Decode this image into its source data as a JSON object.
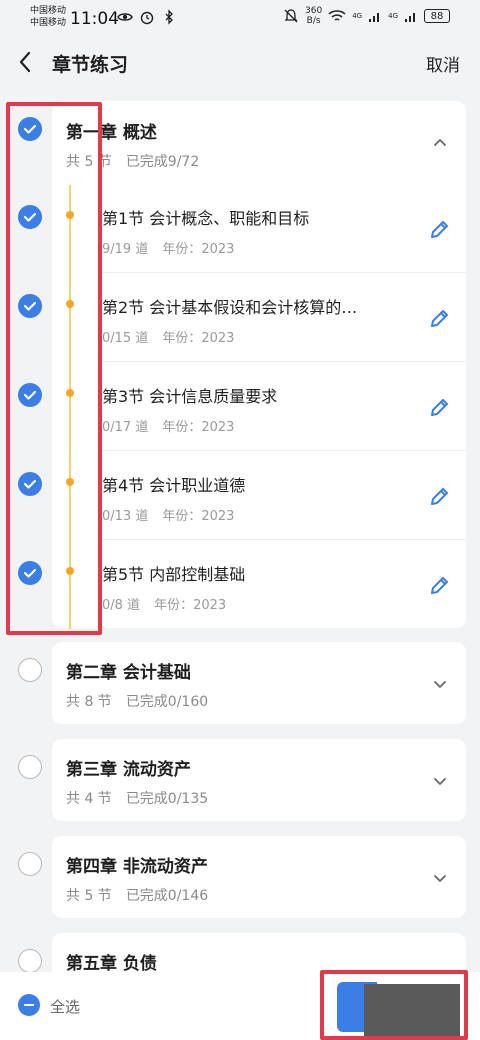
{
  "status_bar": {
    "carrier_1": "中国移动",
    "carrier_2": "中国移动",
    "time": "11:04",
    "net_speed_value": "360",
    "net_speed_unit": "B/s",
    "signal_1_label": "4G",
    "signal_2_label": "4G",
    "battery": "88"
  },
  "header": {
    "title": "章节练习",
    "cancel_label": "取消"
  },
  "chapters": [
    {
      "title": "第一章 概述",
      "sections_count": "共 5 节",
      "progress": "已完成9/72",
      "checked": true,
      "expanded": true,
      "sections": [
        {
          "title": "第1节  会计概念、职能和目标",
          "questions": "9/19 道",
          "year": "年份：2023",
          "checked": true
        },
        {
          "title": "第2节  会计基本假设和会计核算的…",
          "questions": "0/15 道",
          "year": "年份：2023",
          "checked": true
        },
        {
          "title": "第3节  会计信息质量要求",
          "questions": "0/17 道",
          "year": "年份：2023",
          "checked": true
        },
        {
          "title": "第4节  会计职业道德",
          "questions": "0/13 道",
          "year": "年份：2023",
          "checked": true
        },
        {
          "title": "第5节  内部控制基础",
          "questions": "0/8 道",
          "year": "年份：2023",
          "checked": true
        }
      ]
    },
    {
      "title": "第二章 会计基础",
      "sections_count": "共 8 节",
      "progress": "已完成0/160",
      "checked": false,
      "expanded": false
    },
    {
      "title": "第三章 流动资产",
      "sections_count": "共 4 节",
      "progress": "已完成0/135",
      "checked": false,
      "expanded": false
    },
    {
      "title": "第四章 非流动资产",
      "sections_count": "共 5 节",
      "progress": "已完成0/146",
      "checked": false,
      "expanded": false
    },
    {
      "title": "第五章 负债",
      "checked": false,
      "expanded": false
    }
  ],
  "bottom_bar": {
    "select_all_label": "全选"
  },
  "colors": {
    "accent": "#3a7ee6",
    "timeline": "#f5a623",
    "highlight": "#e23a4a"
  }
}
